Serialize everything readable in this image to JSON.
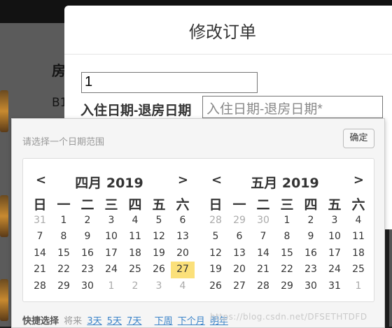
{
  "background": {
    "table_header": "房",
    "table_cell": "B1"
  },
  "modal": {
    "title": "修改订单",
    "order_input_value": "1",
    "date_label": "入住日期-退房日期",
    "date_placeholder": "入住日期-退房日期*"
  },
  "picker": {
    "hint": "请选择一个日期范围",
    "confirm_label": "确定",
    "prev_glyph": "<",
    "next_glyph": ">",
    "weekdays": [
      "日",
      "一",
      "二",
      "三",
      "四",
      "五",
      "六"
    ],
    "left_month": {
      "caption": "四月 2019",
      "days": [
        {
          "t": "31",
          "o": true
        },
        {
          "t": "1"
        },
        {
          "t": "2"
        },
        {
          "t": "3"
        },
        {
          "t": "4"
        },
        {
          "t": "5"
        },
        {
          "t": "6"
        },
        {
          "t": "7"
        },
        {
          "t": "8"
        },
        {
          "t": "9"
        },
        {
          "t": "10"
        },
        {
          "t": "11"
        },
        {
          "t": "12"
        },
        {
          "t": "13"
        },
        {
          "t": "14"
        },
        {
          "t": "15"
        },
        {
          "t": "16"
        },
        {
          "t": "17"
        },
        {
          "t": "18"
        },
        {
          "t": "19"
        },
        {
          "t": "20"
        },
        {
          "t": "21"
        },
        {
          "t": "22"
        },
        {
          "t": "23"
        },
        {
          "t": "24"
        },
        {
          "t": "25"
        },
        {
          "t": "26"
        },
        {
          "t": "27",
          "today": true
        },
        {
          "t": "28"
        },
        {
          "t": "29"
        },
        {
          "t": "30"
        },
        {
          "t": "1",
          "o": true
        },
        {
          "t": "2",
          "o": true
        },
        {
          "t": "3",
          "o": true
        },
        {
          "t": "4",
          "o": true
        }
      ]
    },
    "right_month": {
      "caption": "五月 2019",
      "days": [
        {
          "t": "28",
          "o": true
        },
        {
          "t": "29",
          "o": true
        },
        {
          "t": "30",
          "o": true
        },
        {
          "t": "1"
        },
        {
          "t": "2"
        },
        {
          "t": "3"
        },
        {
          "t": "4"
        },
        {
          "t": "5"
        },
        {
          "t": "6"
        },
        {
          "t": "7"
        },
        {
          "t": "8"
        },
        {
          "t": "9"
        },
        {
          "t": "10"
        },
        {
          "t": "11"
        },
        {
          "t": "12"
        },
        {
          "t": "13"
        },
        {
          "t": "14"
        },
        {
          "t": "15"
        },
        {
          "t": "16"
        },
        {
          "t": "17"
        },
        {
          "t": "18"
        },
        {
          "t": "19"
        },
        {
          "t": "20"
        },
        {
          "t": "21"
        },
        {
          "t": "22"
        },
        {
          "t": "23"
        },
        {
          "t": "24"
        },
        {
          "t": "25"
        },
        {
          "t": "26"
        },
        {
          "t": "27"
        },
        {
          "t": "28"
        },
        {
          "t": "29"
        },
        {
          "t": "30"
        },
        {
          "t": "31"
        },
        {
          "t": "1",
          "o": true
        }
      ]
    },
    "quick": {
      "label": "快捷选择",
      "future_label": "将来",
      "links_a": [
        "3天",
        "5天",
        "7天"
      ],
      "links_b": [
        "下周",
        "下个月",
        "明年"
      ]
    }
  },
  "watermark": "https://blog.csdn.net/DFSETHTDFD",
  "colors": {
    "today_highlight": "#fbe07a",
    "link": "#3a83c9",
    "muted_day": "#aaaaaa"
  }
}
